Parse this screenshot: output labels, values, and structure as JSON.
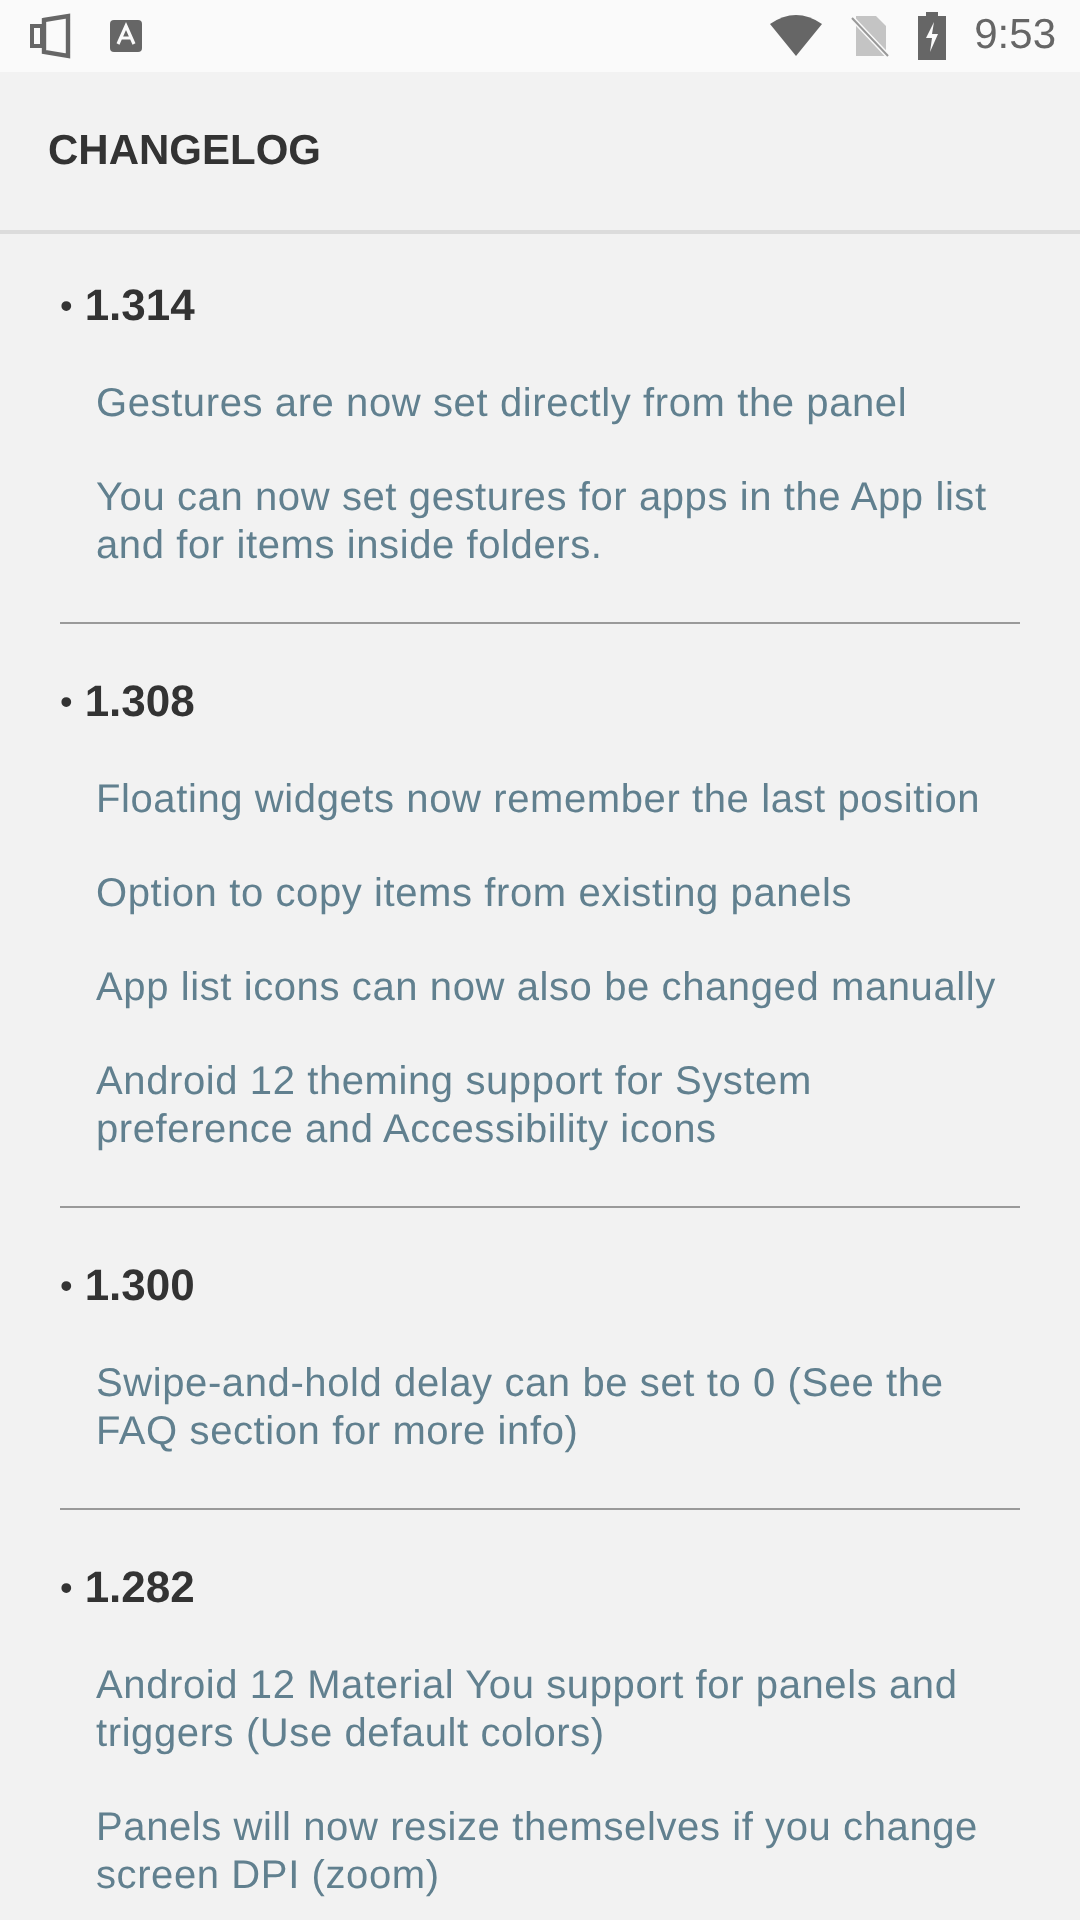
{
  "status_bar": {
    "time": "9:53"
  },
  "header": {
    "title": "CHANGELOG"
  },
  "versions": [
    {
      "bullet": "•",
      "version": "1.314",
      "items": [
        "Gestures are now set directly from the panel",
        "You can now set gestures for apps in the App list and for items inside folders."
      ]
    },
    {
      "bullet": "•",
      "version": "1.308",
      "items": [
        "Floating widgets now remember the last position",
        "Option to copy items from existing panels",
        "App list icons can now also be changed manually",
        "Android 12 theming support for System preference and Accessibility icons"
      ]
    },
    {
      "bullet": "•",
      "version": "1.300",
      "items": [
        "Swipe-and-hold delay can be set to 0 (See the FAQ section for more info)"
      ]
    },
    {
      "bullet": "•",
      "version": "1.282",
      "items": [
        "Android 12 Material You support for panels and triggers (Use default colors)",
        "Panels will now resize themselves if you change screen DPI (zoom)"
      ]
    }
  ]
}
